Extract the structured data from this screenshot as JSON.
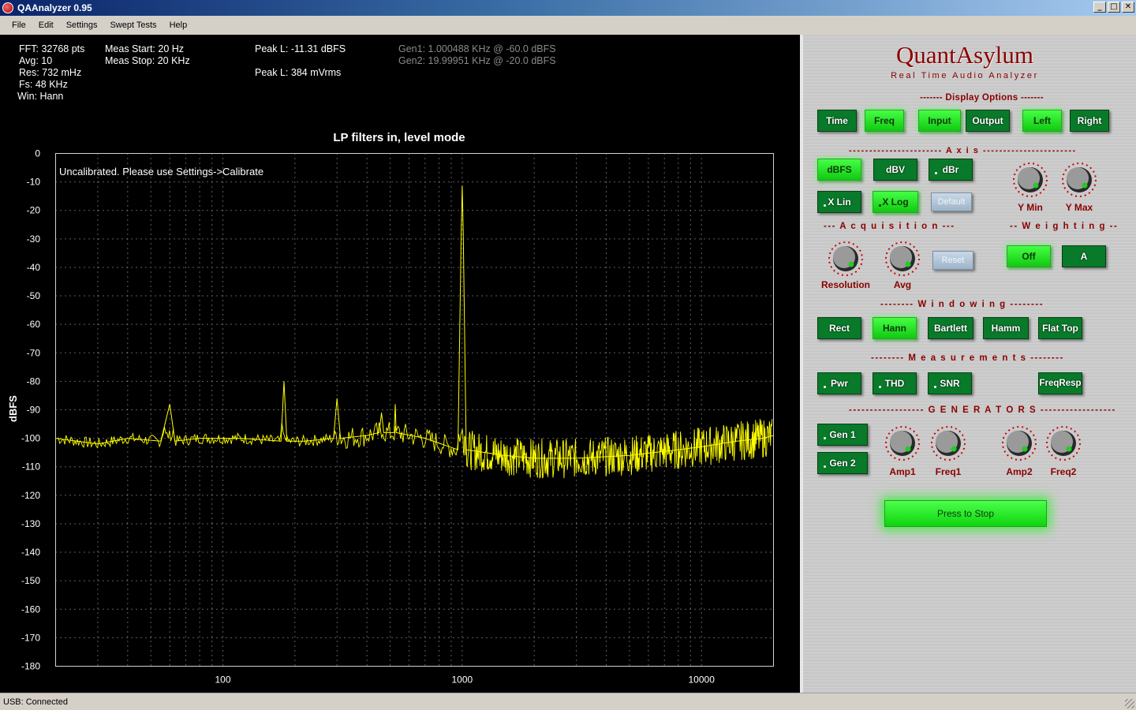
{
  "window": {
    "title": "QAAnalyzer 0.95",
    "min_glyph": "_",
    "max_glyph": "□",
    "close_glyph": "✕"
  },
  "menu": [
    "File",
    "Edit",
    "Settings",
    "Swept Tests",
    "Help"
  ],
  "info": {
    "col1": [
      "FFT: 32768 pts",
      "Avg: 10",
      "Res: 732 mHz",
      "Fs: 48 KHz",
      "Win: Hann"
    ],
    "col2": [
      "Meas Start: 20 Hz",
      "Meas Stop: 20 KHz"
    ],
    "peak_dbfs": "Peak L: -11.31 dBFS",
    "peak_mv": "Peak L: 384 mVrms",
    "gen1": "Gen1: 1.000488 KHz @ -60.0 dBFS",
    "gen2": "Gen2: 19.99951 KHz @ -20.0 dBFS"
  },
  "chart_data": {
    "type": "line",
    "title": "LP filters in, level mode",
    "ylabel": "dBFS",
    "annotation": "Uncalibrated. Please use Settings->Calibrate",
    "xscale": "log",
    "xlim": [
      20,
      20000
    ],
    "ylim": [
      -180,
      0
    ],
    "yticks": [
      0,
      -10,
      -20,
      -30,
      -40,
      -50,
      -60,
      -70,
      -80,
      -90,
      -100,
      -110,
      -120,
      -130,
      -140,
      -150,
      -160,
      -170,
      -180
    ],
    "xticks": [
      100,
      1000,
      10000
    ],
    "grid": true,
    "line_color": "#ffff00",
    "series": [
      {
        "x": [
          20,
          30,
          40,
          55,
          60,
          63,
          80,
          120,
          175,
          180,
          185,
          220,
          290,
          300,
          310,
          400,
          450,
          460,
          470,
          520,
          525,
          530,
          700,
          960,
          990,
          1000,
          1010,
          1040,
          1500,
          2000,
          3000,
          5000,
          8000,
          10000,
          14000,
          18000,
          20000
        ],
        "y": [
          -100,
          -102,
          -100,
          -101,
          -88,
          -101,
          -100,
          -100,
          -101,
          -80,
          -101,
          -101,
          -100,
          -86,
          -100,
          -99,
          -98,
          -91,
          -98,
          -98,
          -88,
          -98,
          -100,
          -104,
          -30,
          -11.3,
          -28,
          -104,
          -106,
          -107,
          -107,
          -106,
          -104,
          -103,
          -101,
          -100,
          -99
        ]
      }
    ]
  },
  "panel": {
    "brand": "QuantAsylum",
    "brand_sub": "Real Time Audio Analyzer",
    "sections": {
      "display": "------- Display Options -------",
      "axis": "----------------------- A x i s -----------------------",
      "acq": "--- A c q u i s i t i o n ---",
      "weight": "-- W e i g h t i n g --",
      "window": "-------- W i n d o w i n g --------",
      "meas": "-------- M e a s u r e m e n t s --------",
      "gen": "------------------ G E N E R A T O R S ------------------"
    },
    "display_buttons": [
      "Time",
      "Freq",
      "Input",
      "Output",
      "Left",
      "Right"
    ],
    "axis_buttons": [
      "dBFS",
      "dBV",
      "dBr"
    ],
    "x_buttons": [
      "X Lin",
      "X Log",
      "Default"
    ],
    "axis_knobs": [
      "Y Min",
      "Y Max"
    ],
    "acq_knobs": [
      "Resolution",
      "Avg"
    ],
    "reset": "Reset",
    "weight_buttons": [
      "Off",
      "A"
    ],
    "window_buttons": [
      "Rect",
      "Hann",
      "Bartlett",
      "Hamm",
      "Flat Top"
    ],
    "meas_buttons": [
      "Pwr",
      "THD",
      "SNR",
      "FreqResp"
    ],
    "gen_buttons": [
      "Gen 1",
      "Gen 2"
    ],
    "gen_knobs": [
      "Amp1",
      "Freq1",
      "Amp2",
      "Freq2"
    ],
    "stop": "Press to Stop"
  },
  "status": "USB: Connected"
}
